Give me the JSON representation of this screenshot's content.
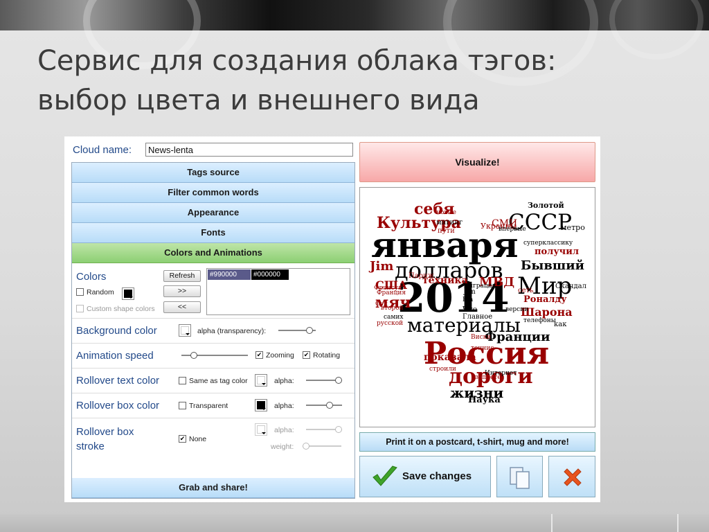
{
  "slide": {
    "title_line1": "Сервис для создания облака тэгов:",
    "title_line2": "выбор цвета и внешнего вида"
  },
  "form": {
    "cloud_name_label": "Cloud name:",
    "cloud_name_value": "News-lenta"
  },
  "accordion": {
    "tags_source": "Tags source",
    "filter_common_words": "Filter common words",
    "appearance": "Appearance",
    "fonts": "Fonts",
    "colors_and_animations": "Colors and Animations",
    "grab_and_share": "Grab and share!"
  },
  "colors_panel": {
    "colors_label": "Colors",
    "random_label": "Random",
    "custom_shape_colors_label": "Custom shape colors",
    "refresh_button": "Refresh",
    "add_button": ">>",
    "remove_button": "<<",
    "color_list": [
      {
        "label": "#990000",
        "bg": "#5a5a8a"
      },
      {
        "label": "#000000",
        "bg": "#000000"
      }
    ],
    "background_color_label": "Background color",
    "alpha_transparency_label": "alpha (transparency):",
    "animation_speed_label": "Animation speed",
    "zooming_label": "Zooming",
    "rotating_label": "Rotating",
    "rollover_text_color_label": "Rollover text color",
    "same_as_tag_color_label": "Same as tag color",
    "alpha_label": "alpha:",
    "rollover_box_color_label": "Rollover box color",
    "transparent_label": "Transparent",
    "rollover_box_stroke_line1": "Rollover box",
    "rollover_box_stroke_line2": "stroke",
    "none_label": "None",
    "weight_label": "weight:",
    "levels": {
      "background_alpha": 0.9,
      "animation_speed": 0.15,
      "rollover_text_alpha": 1.0,
      "rollover_box_alpha": 0.7,
      "stroke_alpha": 1.0,
      "stroke_weight": 0.0
    },
    "checked": {
      "random": false,
      "custom_shape_colors": false,
      "zooming": true,
      "rotating": true,
      "same_as_tag_color": false,
      "transparent": false,
      "none": true
    }
  },
  "right_panel": {
    "visualize_button": "Visualize!",
    "print_button": "Print it on a postcard, t-shirt, mug and more!",
    "save_changes_button": "Save changes"
  },
  "cloud": {
    "shape": "heart",
    "colors": [
      "#990000",
      "#000000"
    ],
    "words": [
      {
        "text": "января",
        "color": "#000000"
      },
      {
        "text": "2014",
        "color": "#000000"
      },
      {
        "text": "Россия",
        "color": "#990000"
      },
      {
        "text": "долларов",
        "color": "#000000"
      },
      {
        "text": "материалы",
        "color": "#000000"
      },
      {
        "text": "Мир",
        "color": "#000000"
      },
      {
        "text": "СССР",
        "color": "#000000"
      },
      {
        "text": "Культура",
        "color": "#990000"
      },
      {
        "text": "себя",
        "color": "#990000"
      },
      {
        "text": "дороги",
        "color": "#990000"
      },
      {
        "text": "жизни",
        "color": "#000000"
      },
      {
        "text": "Бывший",
        "color": "#000000"
      },
      {
        "text": "Франции",
        "color": "#000000"
      },
      {
        "text": "мяч",
        "color": "#990000"
      },
      {
        "text": "Шарона",
        "color": "#990000"
      },
      {
        "text": "МВД",
        "color": "#990000"
      },
      {
        "text": "техника",
        "color": "#990000"
      },
      {
        "text": "США",
        "color": "#990000"
      },
      {
        "text": "Jim",
        "color": "#990000"
      },
      {
        "text": "показала",
        "color": "#990000"
      },
      {
        "text": "Наука",
        "color": "#000000"
      },
      {
        "text": "Золотой",
        "color": "#000000"
      },
      {
        "text": "получил",
        "color": "#990000"
      },
      {
        "text": "Роналду",
        "color": "#990000"
      },
      {
        "text": "миграция",
        "color": "#000000"
      },
      {
        "text": "СМИ",
        "color": "#990000"
      },
      {
        "text": "Украины",
        "color": "#990000"
      },
      {
        "text": "метро",
        "color": "#000000"
      },
      {
        "text": "суперклассику",
        "color": "#000000"
      },
      {
        "text": "телефоны",
        "color": "#000000"
      },
      {
        "text": "Интернет",
        "color": "#000000"
      },
      {
        "text": "Франция",
        "color": "#990000"
      },
      {
        "text": "Суд",
        "color": "#990000"
      },
      {
        "text": "Что",
        "color": "#000000"
      },
      {
        "text": "Главное",
        "color": "#000000"
      },
      {
        "text": "Виски",
        "color": "#990000"
      },
      {
        "text": "впервые",
        "color": "#000000"
      },
      {
        "text": "Jim",
        "color": "#000000"
      },
      {
        "text": "теннис",
        "color": "#990000"
      },
      {
        "text": "запрете",
        "color": "#990000"
      },
      {
        "text": "Париж",
        "color": "#990000"
      },
      {
        "text": "второй",
        "color": "#990000"
      },
      {
        "text": "самих",
        "color": "#000000"
      },
      {
        "text": "русской",
        "color": "#990000"
      },
      {
        "text": "строили",
        "color": "#990000"
      },
      {
        "text": "Франсуа",
        "color": "#990000"
      },
      {
        "text": "мигинг",
        "color": "#000000"
      },
      {
        "text": "как",
        "color": "#000000"
      },
      {
        "text": "новые",
        "color": "#990000"
      },
      {
        "text": "Скандал",
        "color": "#000000"
      },
      {
        "text": "версии",
        "color": "#000000"
      },
      {
        "text": "Кіа",
        "color": "#000000"
      },
      {
        "text": "пути",
        "color": "#990000"
      },
      {
        "text": "сеть",
        "color": "#990000"
      }
    ]
  }
}
